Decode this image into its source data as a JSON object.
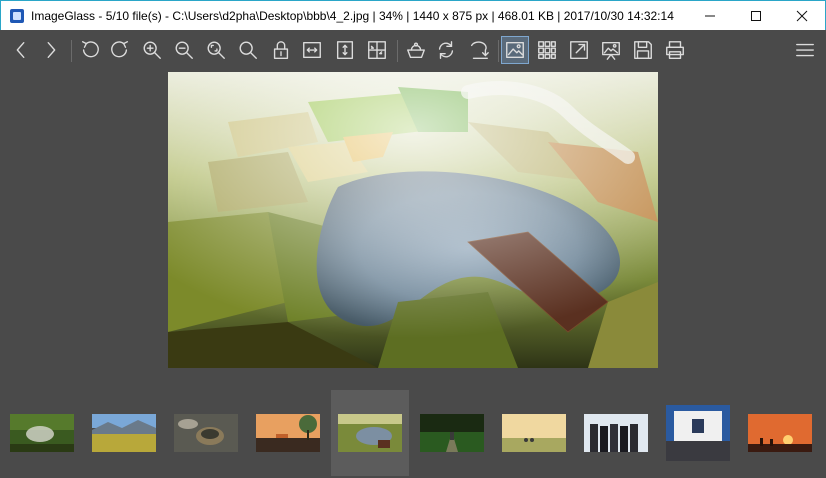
{
  "window": {
    "title": "ImageGlass - 5/10 file(s) - C:\\Users\\d2pha\\Desktop\\bbb\\4_2.jpg  |  34%  |  1440 x 875 px  |  468.01 KB  |  2017/10/30 14:32:14",
    "app_icon": "imageglass-logo-icon",
    "controls": [
      "minimize-icon",
      "maximize-icon",
      "close-icon"
    ]
  },
  "toolbar": {
    "buttons": [
      {
        "name": "previous-image",
        "icon": "chevron-left-icon"
      },
      {
        "name": "next-image",
        "icon": "chevron-right-icon"
      },
      {
        "name": "rotate-left",
        "icon": "rotate-left-icon"
      },
      {
        "name": "rotate-right",
        "icon": "rotate-right-icon"
      },
      {
        "name": "zoom-in",
        "icon": "zoom-in-icon"
      },
      {
        "name": "zoom-out",
        "icon": "zoom-out-icon"
      },
      {
        "name": "scale-to-fit",
        "icon": "zoom-fit-icon"
      },
      {
        "name": "actual-size",
        "icon": "magnifier-icon"
      },
      {
        "name": "lock-zoom",
        "icon": "lock-icon"
      },
      {
        "name": "scale-to-width",
        "icon": "fit-width-icon"
      },
      {
        "name": "scale-to-height",
        "icon": "fit-height-icon"
      },
      {
        "name": "auto-zoom",
        "icon": "auto-zoom-icon"
      },
      {
        "name": "open-file",
        "icon": "basket-icon"
      },
      {
        "name": "refresh",
        "icon": "refresh-icon"
      },
      {
        "name": "go-to-image",
        "icon": "goto-icon"
      },
      {
        "name": "thumbnail-bar",
        "icon": "image-icon",
        "active": true
      },
      {
        "name": "checkerboard",
        "icon": "grid-icon"
      },
      {
        "name": "fullscreen",
        "icon": "fullscreen-icon"
      },
      {
        "name": "slideshow",
        "icon": "slideshow-icon"
      },
      {
        "name": "convert",
        "icon": "save-icon"
      },
      {
        "name": "print",
        "icon": "printer-icon"
      },
      {
        "name": "main-menu",
        "icon": "hamburger-menu-icon"
      }
    ]
  },
  "viewer": {
    "zoom": "34%",
    "image": "aerial-rice-fields-lake"
  },
  "thumbnails": {
    "count": 10,
    "selected_index": 4,
    "items": [
      {
        "name": "thumb-1",
        "scene": "forest-smoke"
      },
      {
        "name": "thumb-2",
        "scene": "mountain-field"
      },
      {
        "name": "thumb-3",
        "scene": "bowls-closeup"
      },
      {
        "name": "thumb-4",
        "scene": "sunset-tree"
      },
      {
        "name": "thumb-5",
        "scene": "aerial-fields",
        "selected": true
      },
      {
        "name": "thumb-6",
        "scene": "person-forest-path"
      },
      {
        "name": "thumb-7",
        "scene": "cyclist-field"
      },
      {
        "name": "thumb-8",
        "scene": "group-people"
      },
      {
        "name": "thumb-9",
        "scene": "building-group"
      },
      {
        "name": "thumb-10",
        "scene": "sunset-silhouettes"
      }
    ]
  },
  "colors": {
    "background": "#4a4a4a",
    "titlebar": "#ffffff",
    "accent_border": "#2aa6c8",
    "selected_thumb": "#5c5c5c",
    "toolbar_icon": "#dcdcdc"
  }
}
